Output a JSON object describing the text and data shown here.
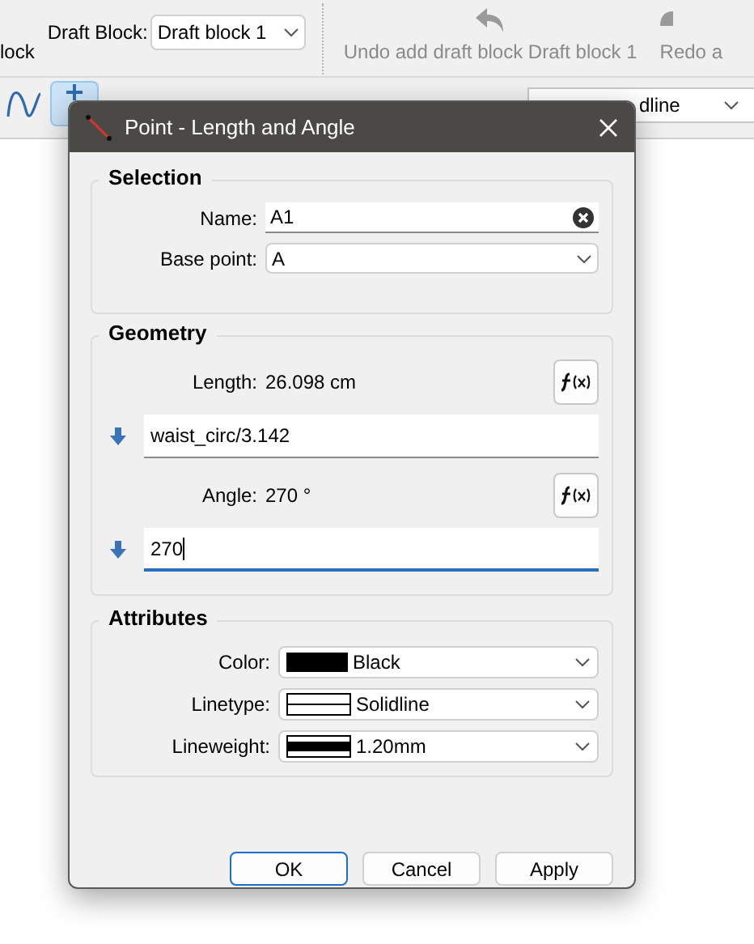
{
  "toolbar": {
    "cut_label": "lock",
    "draft_block_label": "Draft Block:",
    "draft_block_value": "Draft block 1",
    "undo_label": "Undo add draft block Draft block 1",
    "redo_label": "Redo a",
    "linetype_value": "dline"
  },
  "dialog": {
    "title": "Point - Length and Angle",
    "selection": {
      "title": "Selection",
      "name_label": "Name:",
      "name_value": "A1",
      "base_point_label": "Base point:",
      "base_point_value": "A"
    },
    "geometry": {
      "title": "Geometry",
      "fields": [
        {
          "label": "Length:",
          "value": "26.098 cm",
          "formula": "waist_circ/3.142",
          "focused": false
        },
        {
          "label": "Angle:",
          "value": "270 °",
          "formula": "270",
          "focused": true
        }
      ]
    },
    "attributes": {
      "title": "Attributes",
      "rows": [
        {
          "kind": "color",
          "label": "Color:",
          "value": "Black"
        },
        {
          "kind": "linetype",
          "label": "Linetype:",
          "value": "Solidline"
        },
        {
          "kind": "lineweight",
          "label": "Lineweight:",
          "value": "1.20mm"
        }
      ]
    },
    "buttons": [
      {
        "label": "OK",
        "default": true
      },
      {
        "label": "Cancel",
        "default": false
      },
      {
        "label": "Apply",
        "default": false
      }
    ]
  }
}
